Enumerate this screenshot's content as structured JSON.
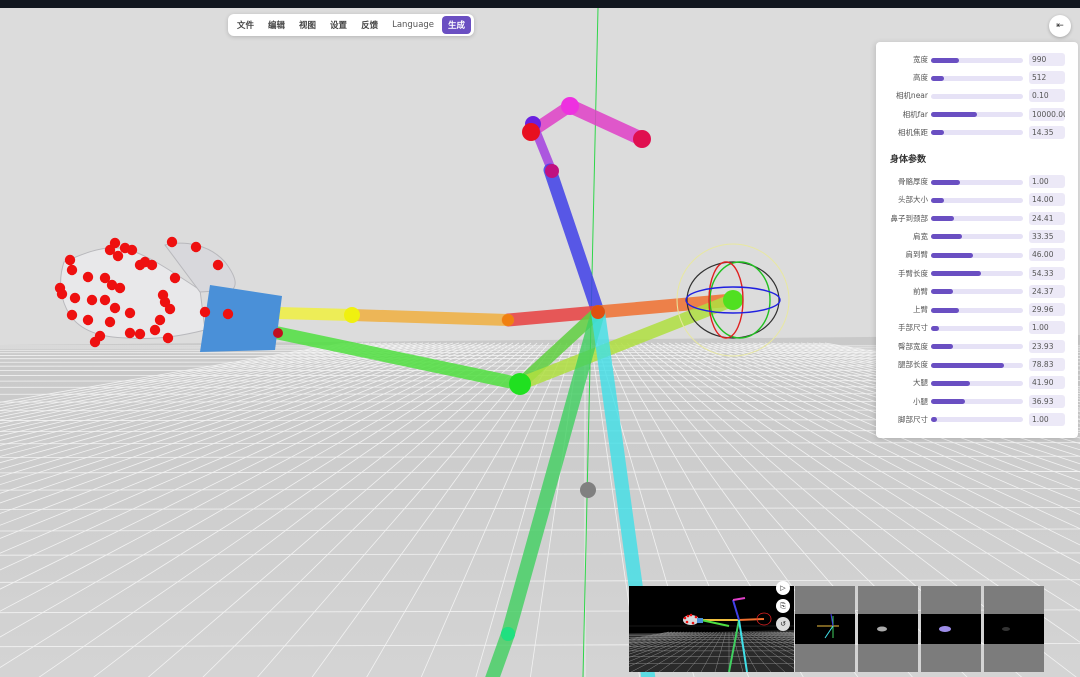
{
  "menu": {
    "items": [
      "文件",
      "编辑",
      "视图",
      "设置",
      "反馈"
    ],
    "language": "Language",
    "generate": "生成"
  },
  "collapse_icon": "⇤",
  "colors": {
    "accent": "#6a4fc2",
    "track": "#e6e2f6",
    "value_bg": "#ece9f7"
  },
  "camera_params": [
    {
      "label": "宽度",
      "value": "990",
      "level": 0.3
    },
    {
      "label": "高度",
      "value": "512",
      "level": 0.14
    },
    {
      "label": "相机near",
      "value": "0.10",
      "level": 0.0
    },
    {
      "label": "相机far",
      "value": "10000.00",
      "level": 0.5
    },
    {
      "label": "相机焦距",
      "value": "14.35",
      "level": 0.14
    }
  ],
  "body_section_title": "身体参数",
  "body_params": [
    {
      "label": "骨骼厚度",
      "value": "1.00",
      "level": 0.31
    },
    {
      "label": "头部大小",
      "value": "14.00",
      "level": 0.14
    },
    {
      "label": "鼻子到颈部",
      "value": "24.41",
      "level": 0.25
    },
    {
      "label": "肩宽",
      "value": "33.35",
      "level": 0.34
    },
    {
      "label": "肩到臂",
      "value": "46.00",
      "level": 0.46
    },
    {
      "label": "手臂长度",
      "value": "54.33",
      "level": 0.54
    },
    {
      "label": "前臂",
      "value": "24.37",
      "level": 0.24
    },
    {
      "label": "上臂",
      "value": "29.96",
      "level": 0.3
    },
    {
      "label": "手部尺寸",
      "value": "1.00",
      "level": 0.09
    },
    {
      "label": "臀部宽度",
      "value": "23.93",
      "level": 0.24
    },
    {
      "label": "腿部长度",
      "value": "78.83",
      "level": 0.79
    },
    {
      "label": "大腿",
      "value": "41.90",
      "level": 0.42
    },
    {
      "label": "小腿",
      "value": "36.93",
      "level": 0.37
    },
    {
      "label": "脚部尺寸",
      "value": "1.00",
      "level": 0.07
    }
  ],
  "preview_controls": [
    "▷",
    "⎘",
    "↺"
  ]
}
